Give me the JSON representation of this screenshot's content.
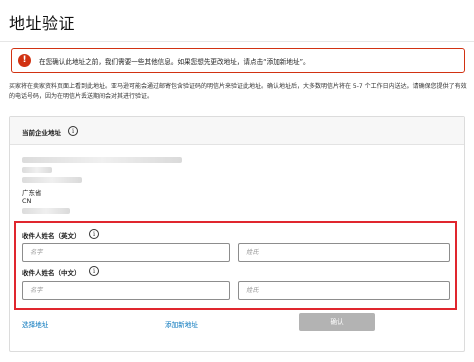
{
  "page": {
    "title": "地址验证"
  },
  "alert": {
    "icon": "exclamation-icon",
    "color": "#d13212",
    "text": "在您确认此地址之前，我们需要一些其他信息。如果您想先更改地址，请点击“添加新地址”。"
  },
  "intro": {
    "text": "买家将在卖家资料页面上看到此地址。亚马逊可能会通过邮寄包含验证码的明信片来验证此地址。确认地址后，大多数明信片将在 5-7 个工作日内送达。请确保您提供了有效的电话号码，因为在明信片丢送期间会对其进行验证。"
  },
  "current_address": {
    "label": "当前企业地址",
    "province": "广东省",
    "country": "CN"
  },
  "form": {
    "en_name_label": "收件人姓名（英文）",
    "cn_name_label": "收件人姓名（中文）",
    "first_name_placeholder": "名字",
    "last_name_placeholder": "姓氏"
  },
  "actions": {
    "select_address": "选择地址",
    "add_new_address": "添加新地址",
    "confirm": "确认"
  },
  "colors": {
    "link": "#0073bb",
    "highlight": "#e0262e",
    "disabled_button": "#b3b3b3"
  }
}
